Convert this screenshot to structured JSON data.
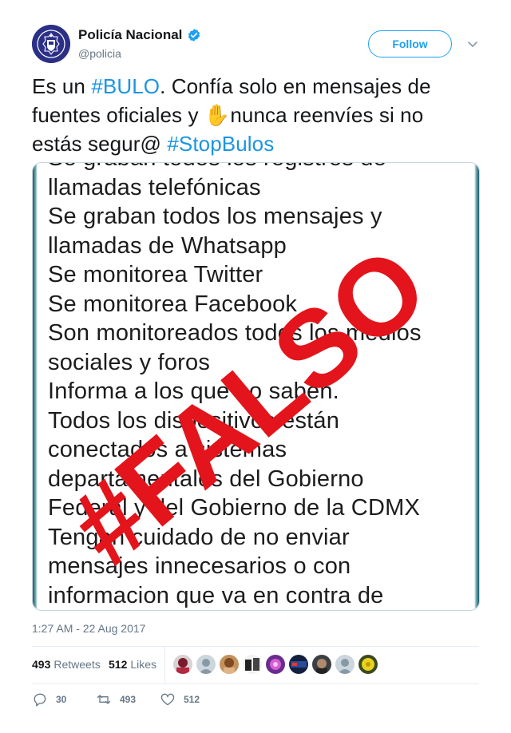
{
  "header": {
    "name": "Policía Nacional",
    "handle": "@policia",
    "follow_label": "Follow",
    "avatar_icon": "police-shield-icon",
    "verified_icon": "verified-badge-icon",
    "menu_icon": "chevron-down-icon"
  },
  "tweet": {
    "part1": "Es un ",
    "hashtag1": "#BULO",
    "part2": ". Confía solo en mensajes de fuentes oficiales y ",
    "emoji": "✋",
    "part3": "nunca reenvíes si no estás segur@ ",
    "hashtag2": "#StopBulos"
  },
  "media": {
    "lines": [
      "Se graban todos los registros de",
      "llamadas telefónicas",
      "Se graban todos los mensajes y",
      "llamadas de Whatsapp",
      "Se monitorea Twitter",
      "Se monitorea Facebook",
      "Son monitoreados todos los medios",
      "sociales y foros",
      "Informa a los que no saben.",
      "Todos los dispositivos están",
      "conectados a sistemas",
      "departamentales del Gobierno",
      "Federal y del Gobierno de la CDMX",
      "Tengan cuidado de no enviar",
      "mensajes innecesarios o con",
      "informacion que va en contra de"
    ],
    "stamp_text": "#FALSO",
    "stamp_color": "#e3141b"
  },
  "timestamp": "1:27 AM - 22 Aug 2017",
  "stats": {
    "retweets_count": "493",
    "retweets_label": "Retweets",
    "likes_count": "512",
    "likes_label": "Likes"
  },
  "actions": {
    "reply_count": "30",
    "retweet_count": "493",
    "like_count": "512",
    "reply_icon": "reply-icon",
    "retweet_icon": "retweet-icon",
    "like_icon": "heart-icon"
  },
  "colors": {
    "accent": "#1da1f2",
    "hashtag": "#1b95e0",
    "muted": "#657786",
    "brand": "#2b2f86"
  }
}
